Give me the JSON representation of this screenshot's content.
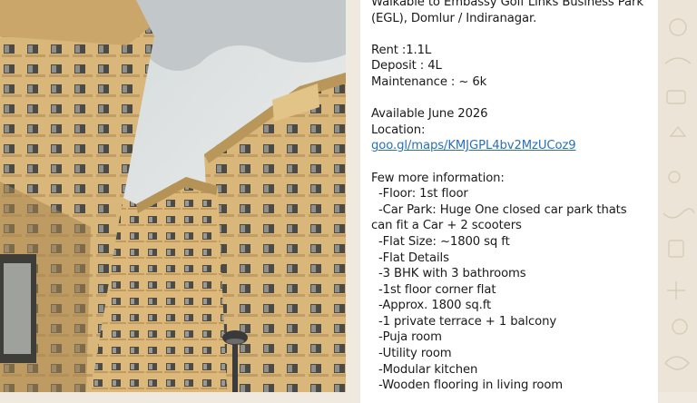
{
  "message": {
    "intro_lines": [
      "Walkable to Embassy Golf Links Business Park",
      "(EGL), Domlur / Indiranagar."
    ],
    "pricing": [
      "Rent :1.1L",
      "Deposit : 4L",
      "Maintenance : ~ 6k"
    ],
    "availability": "Available June 2026",
    "location_label": "Location:",
    "location_link": "goo.gl/maps/KMJGPL4bv2MzUCoz9",
    "info_heading": "Few more information:",
    "info_items": [
      "-Floor: 1st floor",
      "-Car Park: Huge One closed car park thats",
      "can fit a Car + 2 scooters",
      "-Flat Size: ~1800 sq ft",
      "-Flat Details",
      "-3 BHK with 3 bathrooms",
      "-1st floor corner flat",
      "-Approx. 1800 sq.ft",
      "-1 private terrace + 1 balcony",
      "-Puja room",
      "-Utility room",
      "-Modular kitchen",
      "-Wooden flooring in living room"
    ]
  },
  "colors": {
    "link": "#2a6fba",
    "bubble": "#ffffff",
    "wallpaper": "#efe9df"
  }
}
